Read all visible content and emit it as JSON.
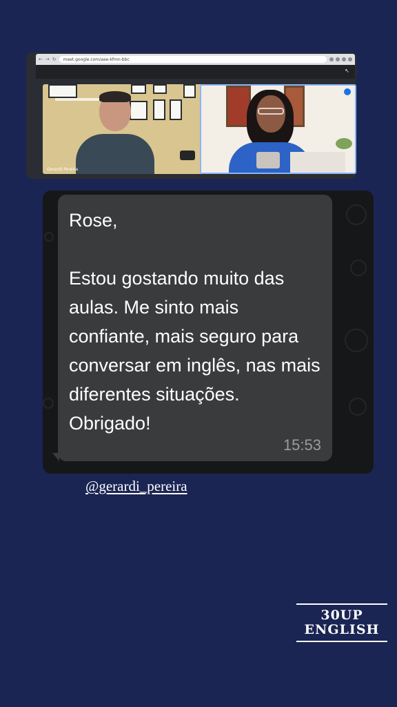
{
  "call": {
    "url": "meet.google.com/aee-kfmn-bbc",
    "participant_left": "Gerardi Pereira"
  },
  "message": {
    "text": "Rose,\n\nEstou gostando muito das aulas. Me sinto mais confiante,  mais seguro para conversar em inglês, nas mais diferentes situações. Obrigado!",
    "time": "15:53"
  },
  "mention": "@gerardi_pereira",
  "logo": {
    "line1": "30UP",
    "line2": "ENGLISH"
  },
  "colors": {
    "background": "#1b2553",
    "bubble": "#3a3b3d",
    "chat_bg": "#151719"
  }
}
